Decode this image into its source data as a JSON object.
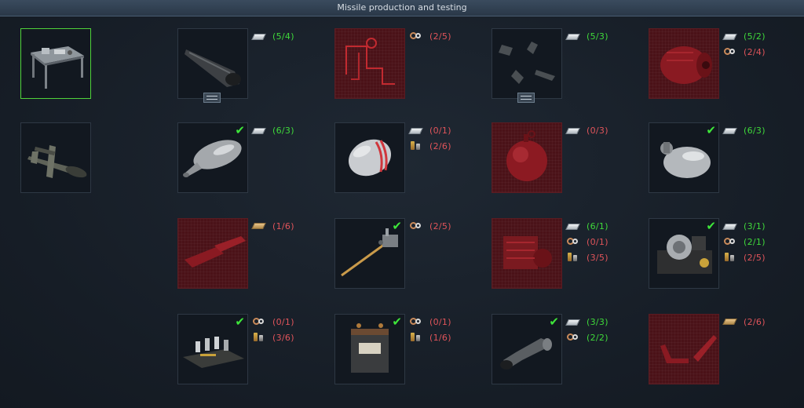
{
  "title": "Missile production and testing",
  "colors": {
    "ok": "#3fd93a",
    "bad": "#e0545a",
    "locked": "#4a1218",
    "selected": "#4fd23a"
  },
  "left_items": [
    {
      "id": "workbench",
      "icon": "workbench-icon",
      "selected": true
    },
    {
      "id": "v1-missile",
      "icon": "v1-missile-icon",
      "selected": false
    }
  ],
  "grid": [
    [
      {
        "name": "nose-cone-part",
        "locked": false,
        "done": false,
        "badge": true,
        "reqs": [
          {
            "icon": "metal-sheet-icon",
            "text": "(5/4)",
            "ok": true
          }
        ]
      },
      {
        "name": "tubing-part",
        "locked": true,
        "done": false,
        "badge": false,
        "reqs": [
          {
            "icon": "wire-icon",
            "text": "(2/5)",
            "ok": false
          }
        ]
      },
      {
        "name": "fins-part",
        "locked": false,
        "done": false,
        "badge": true,
        "reqs": [
          {
            "icon": "metal-sheet-icon",
            "text": "(5/3)",
            "ok": true
          }
        ]
      },
      {
        "name": "motor-part",
        "locked": true,
        "done": false,
        "badge": false,
        "reqs": [
          {
            "icon": "metal-sheet-icon",
            "text": "(5/2)",
            "ok": true
          },
          {
            "icon": "wire-icon",
            "text": "(2/4)",
            "ok": false
          }
        ]
      }
    ],
    [
      {
        "name": "fuel-tank-part",
        "locked": false,
        "done": true,
        "badge": false,
        "reqs": [
          {
            "icon": "metal-sheet-icon",
            "text": "(6/3)",
            "ok": true
          }
        ]
      },
      {
        "name": "warhead-part",
        "locked": false,
        "done": false,
        "badge": false,
        "reqs": [
          {
            "icon": "metal-sheet-icon",
            "text": "(0/1)",
            "ok": false
          },
          {
            "icon": "electronics-icon",
            "text": "(2/6)",
            "ok": false
          }
        ]
      },
      {
        "name": "pressure-sphere-part",
        "locked": true,
        "done": false,
        "badge": false,
        "reqs": [
          {
            "icon": "metal-sheet-icon",
            "text": "(0/3)",
            "ok": false
          }
        ]
      },
      {
        "name": "pressure-tank-part",
        "locked": false,
        "done": true,
        "badge": false,
        "reqs": [
          {
            "icon": "metal-sheet-icon",
            "text": "(6/3)",
            "ok": true
          }
        ]
      }
    ],
    [
      {
        "name": "wing-panels-part",
        "locked": true,
        "done": false,
        "badge": false,
        "reqs": [
          {
            "icon": "wood-plank-icon",
            "text": "(1/6)",
            "ok": false
          }
        ]
      },
      {
        "name": "antenna-rod-part",
        "locked": false,
        "done": true,
        "badge": false,
        "reqs": [
          {
            "icon": "wire-icon",
            "text": "(2/5)",
            "ok": false
          }
        ]
      },
      {
        "name": "engine-block-part",
        "locked": true,
        "done": false,
        "badge": false,
        "reqs": [
          {
            "icon": "metal-sheet-icon",
            "text": "(6/1)",
            "ok": true
          },
          {
            "icon": "wire-icon",
            "text": "(0/1)",
            "ok": false
          },
          {
            "icon": "electronics-icon",
            "text": "(3/5)",
            "ok": false
          }
        ]
      },
      {
        "name": "gyroscope-part",
        "locked": false,
        "done": true,
        "badge": false,
        "reqs": [
          {
            "icon": "metal-sheet-icon",
            "text": "(3/1)",
            "ok": true
          },
          {
            "icon": "wire-icon",
            "text": "(2/1)",
            "ok": true
          },
          {
            "icon": "electronics-icon",
            "text": "(2/5)",
            "ok": false
          }
        ]
      }
    ],
    [
      {
        "name": "circuit-chassis-part",
        "locked": false,
        "done": true,
        "badge": false,
        "reqs": [
          {
            "icon": "wire-icon",
            "text": "(0/1)",
            "ok": false
          },
          {
            "icon": "electronics-icon",
            "text": "(3/6)",
            "ok": false
          }
        ]
      },
      {
        "name": "battery-part",
        "locked": false,
        "done": true,
        "badge": false,
        "reqs": [
          {
            "icon": "wire-icon",
            "text": "(0/1)",
            "ok": false
          },
          {
            "icon": "electronics-icon",
            "text": "(1/6)",
            "ok": false
          }
        ]
      },
      {
        "name": "exhaust-nozzle-part",
        "locked": false,
        "done": true,
        "badge": false,
        "reqs": [
          {
            "icon": "metal-sheet-icon",
            "text": "(3/3)",
            "ok": true
          },
          {
            "icon": "wire-icon",
            "text": "(2/2)",
            "ok": true
          }
        ]
      },
      {
        "name": "bracket-part",
        "locked": true,
        "done": false,
        "badge": false,
        "reqs": [
          {
            "icon": "wood-plank-icon",
            "text": "(2/6)",
            "ok": false
          }
        ]
      }
    ]
  ]
}
